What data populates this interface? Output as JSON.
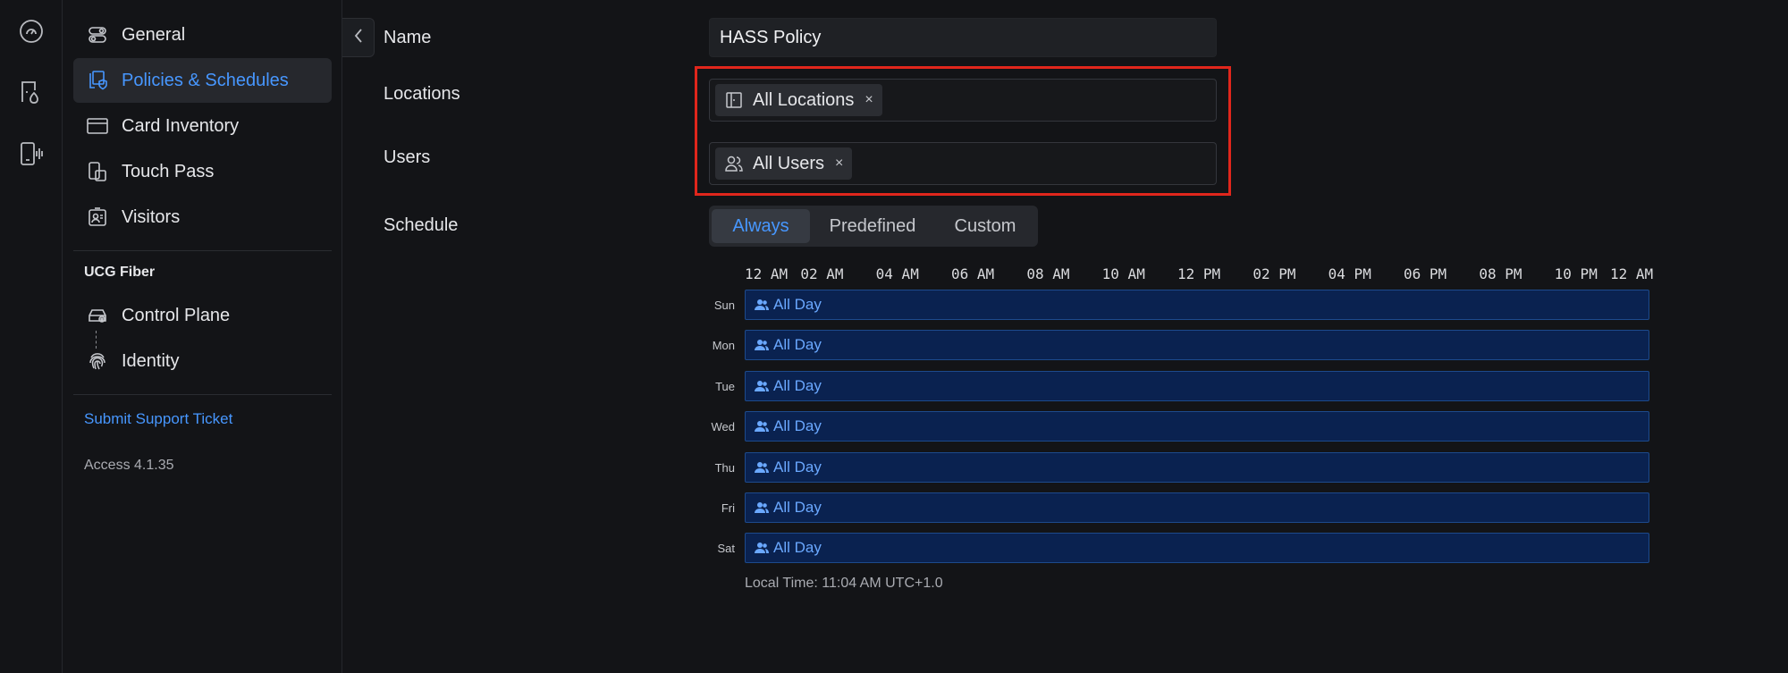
{
  "rail": {
    "icons": [
      "dashboard-icon",
      "door-access-icon",
      "intercom-icon"
    ]
  },
  "sidebar": {
    "items": [
      {
        "label": "General",
        "icon": "toggles-icon"
      },
      {
        "label": "Policies & Schedules",
        "icon": "policy-icon",
        "active": true
      },
      {
        "label": "Card Inventory",
        "icon": "card-icon"
      },
      {
        "label": "Touch Pass",
        "icon": "phone-card-icon"
      },
      {
        "label": "Visitors",
        "icon": "visitor-icon"
      }
    ],
    "section_title": "UCG Fiber",
    "section_items": [
      {
        "label": "Control Plane",
        "icon": "router-icon"
      },
      {
        "label": "Identity",
        "icon": "fingerprint-icon"
      }
    ],
    "support_link": "Submit Support Ticket",
    "version": "Access 4.1.35"
  },
  "form": {
    "name_label": "Name",
    "name_value": "HASS Policy",
    "locations_label": "Locations",
    "locations_chip": "All Locations",
    "users_label": "Users",
    "users_chip": "All Users",
    "chip_remove": "×",
    "schedule_label": "Schedule",
    "schedule_tabs": [
      "Always",
      "Predefined",
      "Custom"
    ],
    "schedule_active": "Always"
  },
  "schedule": {
    "time_ticks": [
      "12 AM",
      "02 AM",
      "04 AM",
      "06 AM",
      "08 AM",
      "10 AM",
      "12 PM",
      "02 PM",
      "04 PM",
      "06 PM",
      "08 PM",
      "10 PM",
      "12 AM"
    ],
    "days": [
      {
        "day": "Sun",
        "label": "All Day"
      },
      {
        "day": "Mon",
        "label": "All Day"
      },
      {
        "day": "Tue",
        "label": "All Day"
      },
      {
        "day": "Wed",
        "label": "All Day"
      },
      {
        "day": "Thu",
        "label": "All Day"
      },
      {
        "day": "Fri",
        "label": "All Day"
      },
      {
        "day": "Sat",
        "label": "All Day"
      }
    ],
    "local_time": "Local Time: 11:04 AM UTC+1.0"
  },
  "colors": {
    "accent": "#4797ff",
    "highlight": "#e0261c",
    "bar_fill": "#0a2250"
  }
}
